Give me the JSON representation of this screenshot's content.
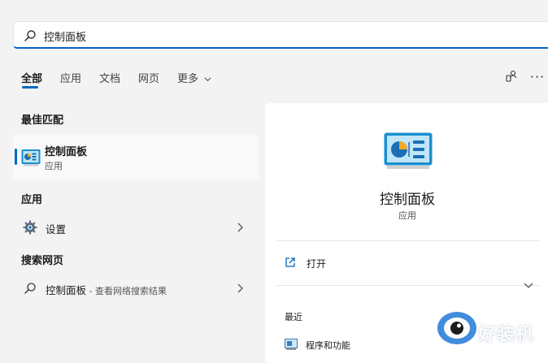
{
  "search": {
    "value": "控制面板",
    "icon": "search-icon"
  },
  "tabs": [
    {
      "label": "全部",
      "active": true
    },
    {
      "label": "应用"
    },
    {
      "label": "文档"
    },
    {
      "label": "网页"
    },
    {
      "label": "更多"
    }
  ],
  "toolbar": {
    "account_icon": "account-switch-icon",
    "more_icon": "more-options-icon",
    "more_label": "···"
  },
  "left": {
    "best_match_header": "最佳匹配",
    "best_match": {
      "title": "控制面板",
      "subtitle": "应用",
      "icon": "control-panel-icon"
    },
    "apps_header": "应用",
    "apps": [
      {
        "label": "设置",
        "icon": "gear-icon"
      }
    ],
    "web_header": "搜索网页",
    "web": [
      {
        "label": "控制面板",
        "suffix": " - 查看网络搜索结果",
        "icon": "search-icon"
      }
    ]
  },
  "preview": {
    "title": "控制面板",
    "subtitle": "应用",
    "actions": [
      {
        "label": "打开",
        "icon": "open-external-icon"
      }
    ],
    "recent_header": "最近",
    "recent": [
      {
        "label": "程序和功能",
        "icon": "programs-features-icon"
      }
    ]
  },
  "watermark": {
    "text": "好装机"
  },
  "colors": {
    "accent": "#0067c0",
    "background": "#f3f3f3",
    "panel": "#ffffff"
  }
}
